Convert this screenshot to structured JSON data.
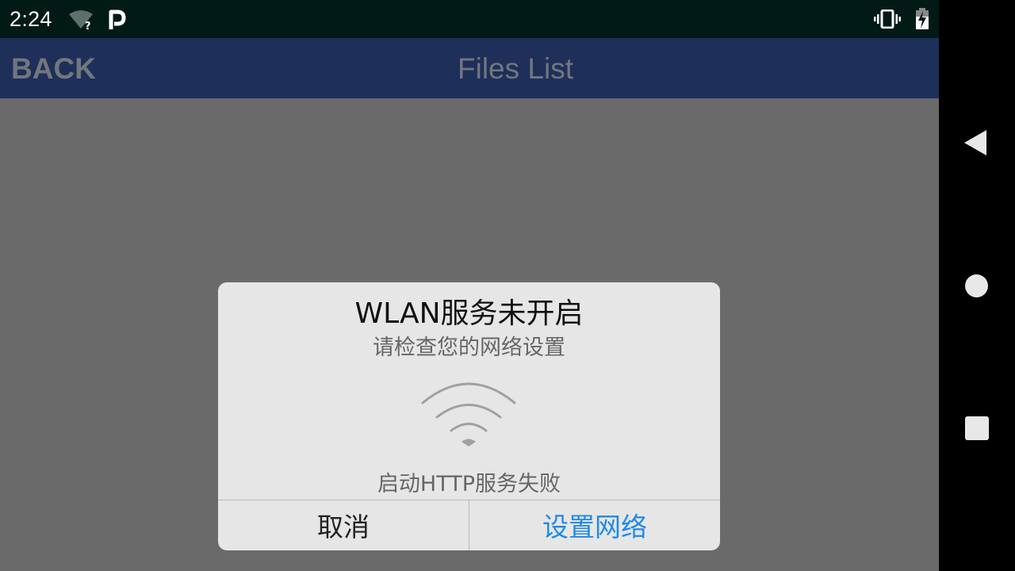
{
  "status_bar": {
    "time": "2:24",
    "icons": [
      "wifi-unknown-icon",
      "parking-p-icon",
      "vibrate-icon",
      "battery-charging-icon"
    ]
  },
  "app_bar": {
    "back_label": "BACK",
    "title": "Files List",
    "background": "#1e2f5a"
  },
  "dialog": {
    "title": "WLAN服务未开启",
    "subtitle": "请检查您的网络设置",
    "icon": "wifi-icon",
    "message": "启动HTTP服务失败",
    "cancel_label": "取消",
    "confirm_label": "设置网络",
    "accent": "#1e8ae8"
  },
  "nav_bar": {
    "icons": [
      "nav-back-icon",
      "nav-home-icon",
      "nav-recents-icon"
    ]
  }
}
